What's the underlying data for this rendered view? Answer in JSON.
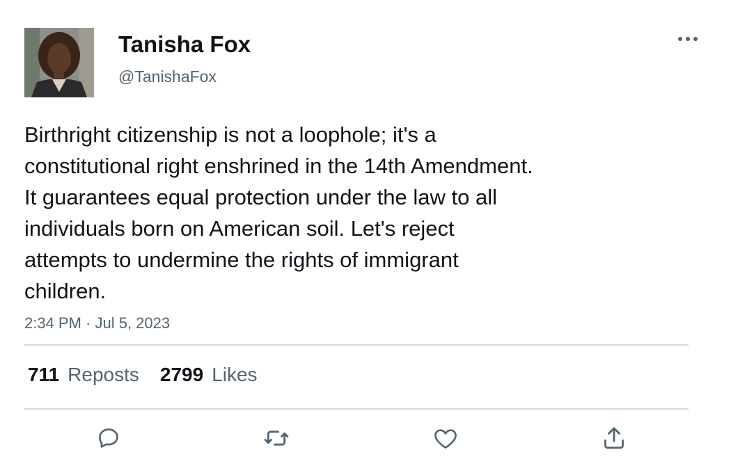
{
  "tweet": {
    "author": {
      "display_name": "Tanisha Fox",
      "handle": "@TanishaFox"
    },
    "text_lines": [
      "Birthright citizenship is not a loophole; it's a",
      "constitutional right enshrined in the 14th Amendment.",
      "It guarantees equal protection under the law to all",
      "individuals born on American soil. Let's reject",
      "attempts to undermine the rights of immigrant",
      "children."
    ],
    "timestamp": "2:34 PM · Jul 5, 2023",
    "stats": {
      "reposts_count": "711",
      "reposts_label": "Reposts",
      "likes_count": "2799",
      "likes_label": "Likes"
    },
    "actions": {
      "reply_icon": "reply-icon",
      "repost_icon": "repost-icon",
      "like_icon": "heart-icon",
      "share_icon": "share-icon"
    }
  },
  "colors": {
    "text_primary": "#0f1419",
    "text_secondary": "#536471",
    "divider": "#cfd9de",
    "icon": "#536471"
  }
}
